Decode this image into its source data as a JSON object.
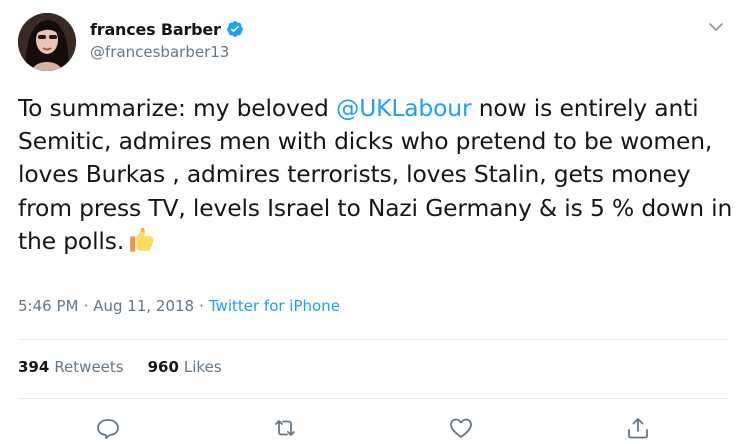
{
  "tweet": {
    "display_name": "frances Barber",
    "handle": "@francesbarber13",
    "text_before": "To summarize: my beloved ",
    "mention": "@UKLabour",
    "text_after": " now is entirely anti Semitic, admires men with dicks who pretend to be women, loves Burkas , admires terrorists, loves Stalin, gets money from press TV, levels Israel to Nazi Germany & is 5 % down in the polls.",
    "emoji": "thumbs-up",
    "time": "5:46 PM",
    "date": "Aug 11, 2018",
    "separator": "·",
    "source": "Twitter for iPhone"
  },
  "stats": {
    "retweets_count": "394",
    "retweets_label": "Retweets",
    "likes_count": "960",
    "likes_label": "Likes"
  },
  "icons": {
    "verified": "verified-badge-icon",
    "more": "chevron-down-icon",
    "reply": "reply-icon",
    "retweet": "retweet-icon",
    "like": "heart-icon",
    "share": "share-icon"
  },
  "colors": {
    "accent": "#1da1f2",
    "text": "#14171a",
    "secondary": "#657786",
    "divider": "#e6ecf0"
  }
}
